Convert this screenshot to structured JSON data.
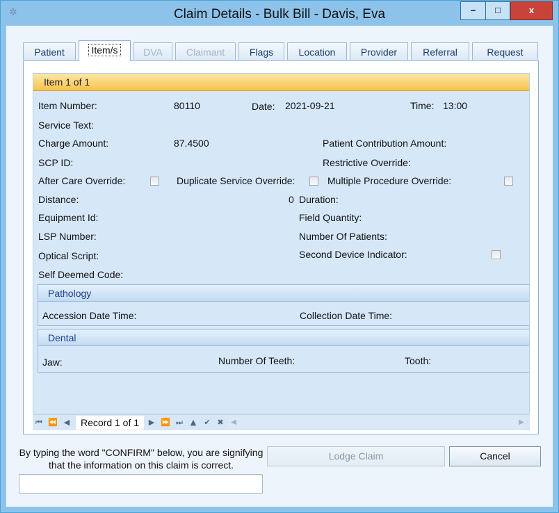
{
  "window": {
    "title": "Claim Details - Bulk Bill - Davis, Eva",
    "app_icon": "app-logo-icon",
    "controls": {
      "minimize": "–",
      "maximize": "□",
      "close": "x"
    }
  },
  "tabs": [
    {
      "label": "Patient",
      "state": "normal"
    },
    {
      "label": "Item/s",
      "state": "active"
    },
    {
      "label": "DVA",
      "state": "disabled"
    },
    {
      "label": "Claimant",
      "state": "disabled"
    },
    {
      "label": "Flags",
      "state": "normal"
    },
    {
      "label": "Location",
      "state": "normal"
    },
    {
      "label": "Provider",
      "state": "normal"
    },
    {
      "label": "Referral",
      "state": "normal"
    },
    {
      "label": "Request",
      "state": "normal"
    }
  ],
  "item": {
    "header": "Item 1 of 1",
    "item_number_label": "Item Number:",
    "item_number": "80110",
    "date_label": "Date:",
    "date": "2021-09-21",
    "time_label": "Time:",
    "time": "13:00",
    "service_text_label": "Service Text:",
    "charge_amount_label": "Charge Amount:",
    "charge_amount": "87.4500",
    "patient_contribution_label": "Patient Contribution Amount:",
    "scp_id_label": "SCP ID:",
    "restrictive_override_label": "Restrictive Override:",
    "after_care_override_label": "After Care Override:",
    "duplicate_service_override_label": "Duplicate Service Override:",
    "multiple_procedure_override_label": "Multiple Procedure Override:",
    "distance_label": "Distance:",
    "distance": "0",
    "duration_label": "Duration:",
    "equipment_id_label": "Equipment Id:",
    "field_quantity_label": "Field Quantity:",
    "lsp_number_label": "LSP Number:",
    "number_of_patients_label": "Number Of Patients:",
    "optical_script_label": "Optical Script:",
    "second_device_indicator_label": "Second Device Indicator:",
    "self_deemed_code_label": "Self Deemed Code:",
    "checkboxes": {
      "after_care_override": false,
      "duplicate_service_override": false,
      "multiple_procedure_override": false,
      "second_device_indicator": false
    }
  },
  "pathology": {
    "header": "Pathology",
    "accession_date_time_label": "Accession Date Time:",
    "collection_date_time_label": "Collection Date Time:"
  },
  "dental": {
    "header": "Dental",
    "jaw_label": "Jaw:",
    "number_of_teeth_label": "Number Of Teeth:",
    "tooth_label": "Tooth:"
  },
  "navigator": {
    "record_text": "Record 1 of 1",
    "buttons": [
      "first-page",
      "previous-page",
      "previous",
      "next",
      "next-page",
      "last",
      "append",
      "post",
      "cancel"
    ]
  },
  "confirm": {
    "instructions": "By typing the word \"CONFIRM\" below, you are signifying that the information on this claim is correct.",
    "input_value": ""
  },
  "buttons": {
    "lodge_claim": "Lodge Claim",
    "cancel": "Cancel"
  }
}
